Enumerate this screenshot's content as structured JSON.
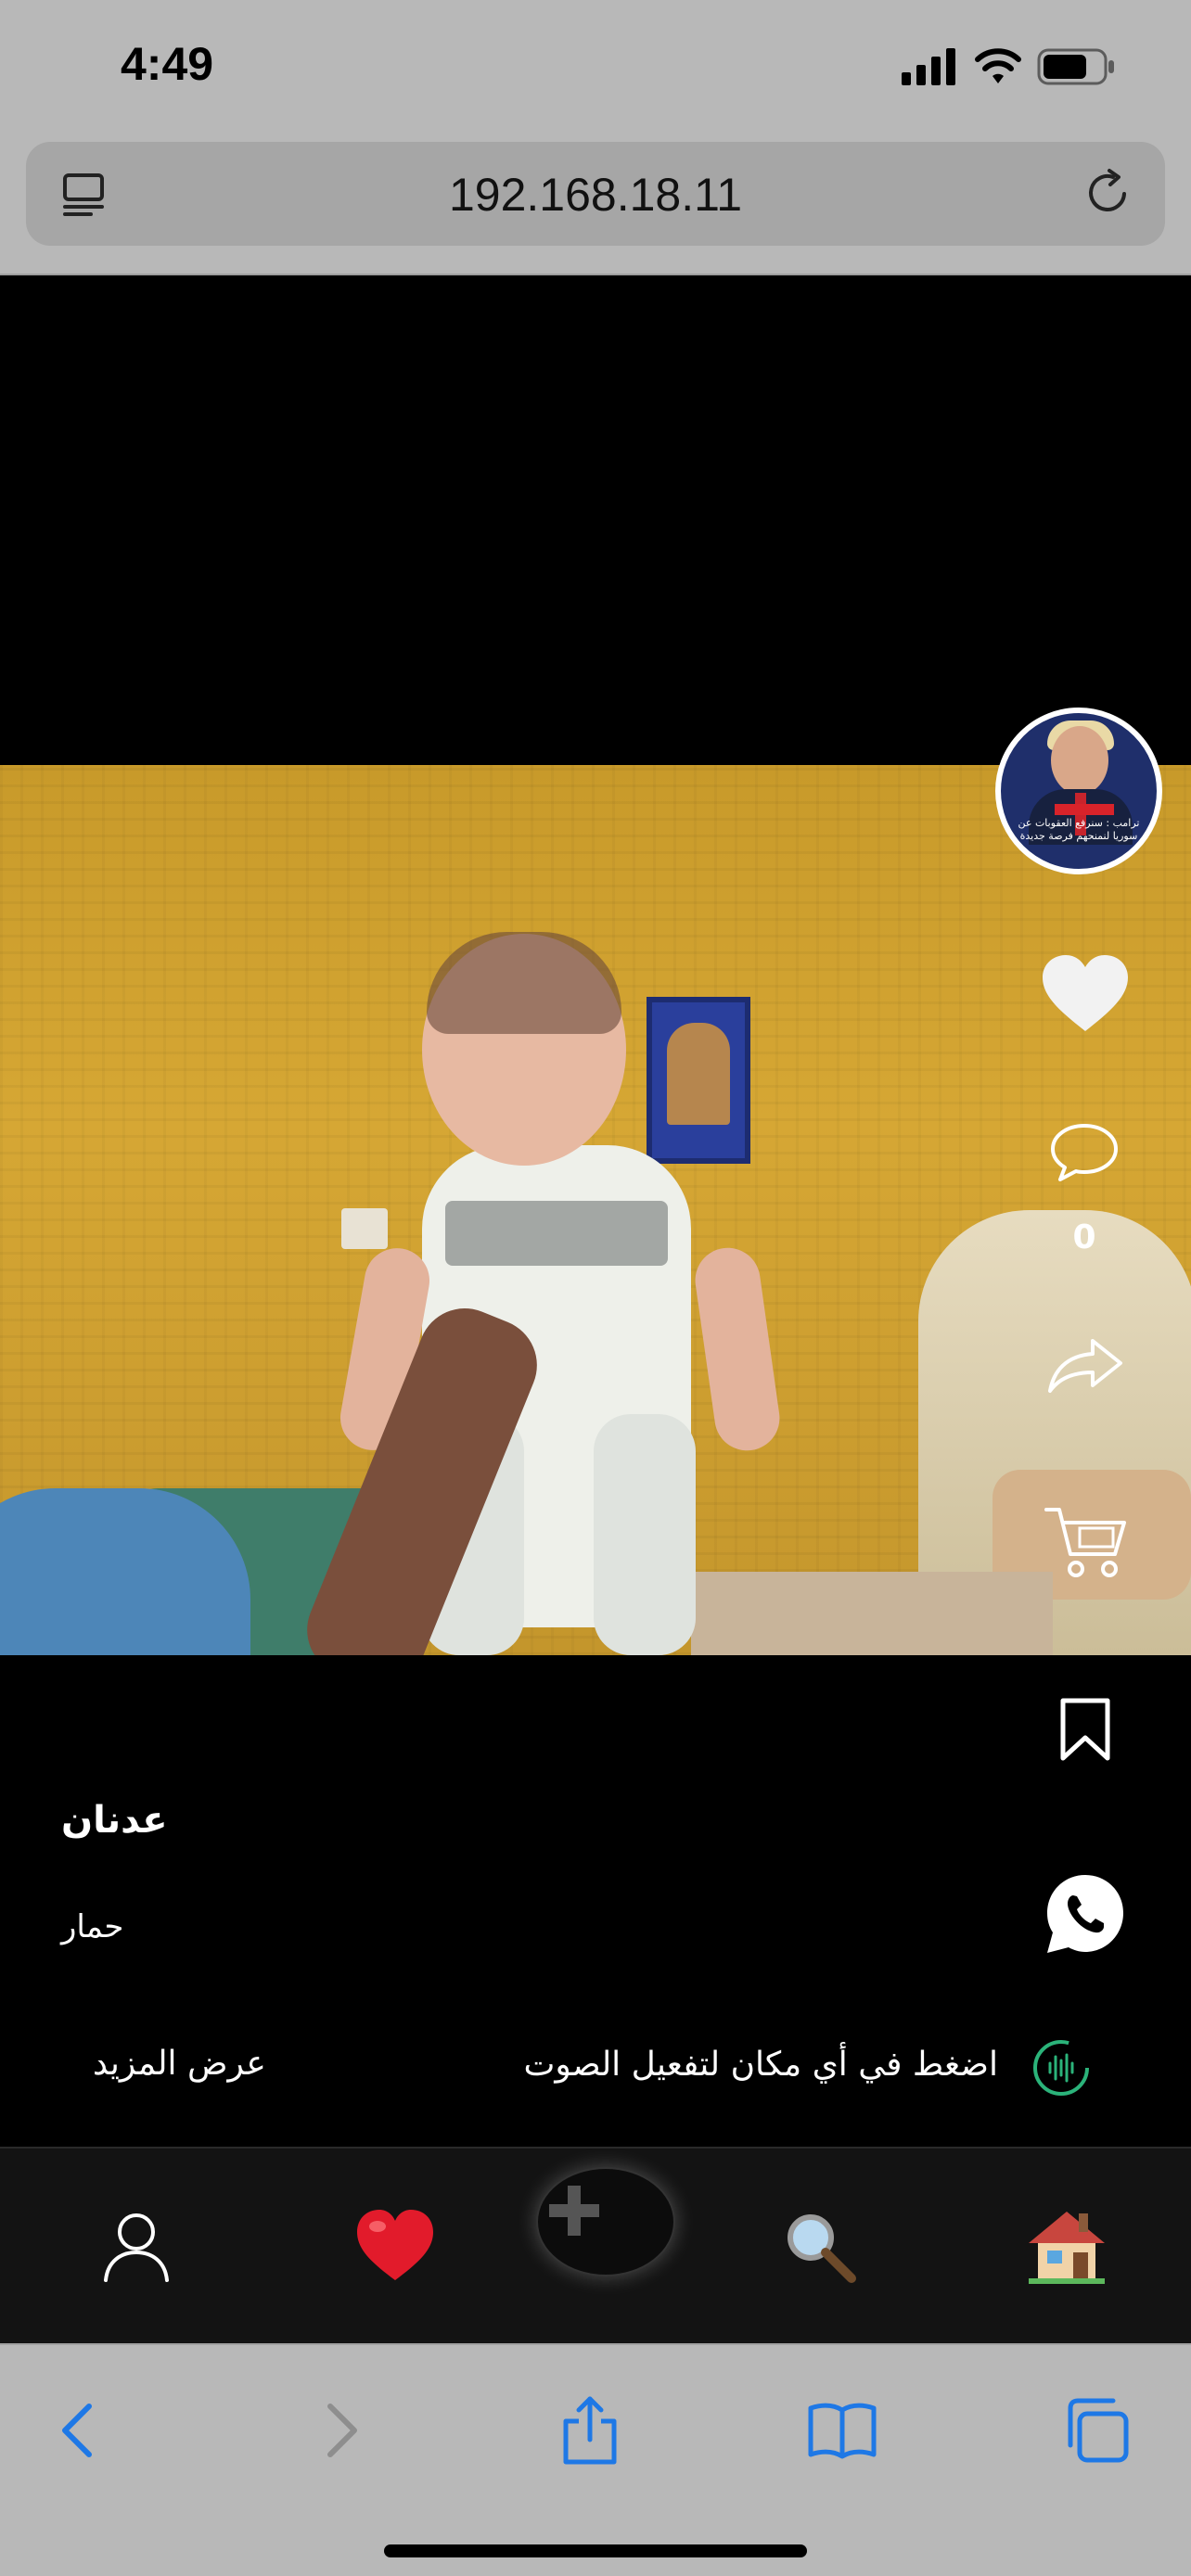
{
  "status_bar": {
    "time": "4:49"
  },
  "browser": {
    "url": "192.168.18.11"
  },
  "post": {
    "avatar_caption": "ترامب : سنرفع العقوبات عن سوريا لنمنحهم فرصة جديدة",
    "comment_count": "0",
    "username": "عدنان",
    "description": "حمار",
    "audio_hint": "اضغط في أي مكان لتفعيل الصوت",
    "show_more": "عرض المزيد"
  },
  "bottom_nav": {
    "items": [
      {
        "name": "profile",
        "icon": "person-icon"
      },
      {
        "name": "likes",
        "icon": "red-heart-icon"
      },
      {
        "name": "add",
        "icon": "plus-icon"
      },
      {
        "name": "search",
        "icon": "magnifier-icon"
      },
      {
        "name": "home",
        "icon": "house-icon"
      }
    ]
  },
  "colors": {
    "accent_blue": "#1e78e6",
    "heart_red": "#e21b2b",
    "audio_green": "#2bb37a"
  }
}
